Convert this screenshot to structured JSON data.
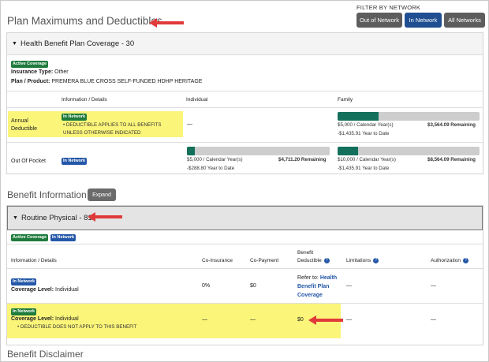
{
  "page_title": "Plan Maximums and Deductibles",
  "filter": {
    "label": "FILTER BY NETWORK",
    "buttons": [
      "Out of Network",
      "In Network",
      "All Networks"
    ],
    "selected": "In Network"
  },
  "plan": {
    "header": "Health Benefit Plan Coverage - 30",
    "badge": "Active Coverage",
    "insurance_type_label": "Insurance Type:",
    "insurance_type": "Other",
    "product_label": "Plan / Product:",
    "product": "PREMERA BLUE CROSS SELF-FUNDED HDHP HERITAGE",
    "columns": [
      "Information / Details",
      "Individual",
      "Family"
    ],
    "rows": [
      {
        "name": "Annual Deductible",
        "network_badge": "In Network",
        "note": "DEDUCTIBLE APPLIES TO ALL BENEFITS UNLESS OTHERWISE INDICATED",
        "individual": "—",
        "family": {
          "limit": "$5,000 / Calendar Year(s)",
          "remaining": "$3,564.09 Remaining",
          "ytd": "-$1,435.91 Year to Date",
          "progress": 0.287
        }
      },
      {
        "name": "Out Of Pocket",
        "network_badge": "In Network",
        "individual": {
          "limit": "$5,000 / Calendar Year(s)",
          "remaining": "$4,711.20 Remaining",
          "ytd": "-$288.80 Year to Date",
          "progress": 0.058
        },
        "family": {
          "limit": "$10,000 / Calendar Year(s)",
          "remaining": "$8,564.09 Remaining",
          "ytd": "-$1,435.91 Year to Date",
          "progress": 0.144
        }
      }
    ]
  },
  "benefit_info": {
    "title": "Benefit Information",
    "expand": "Expand"
  },
  "routine": {
    "header": "Routine Physical - 81",
    "badges": [
      "Active Coverage",
      "In Network"
    ],
    "columns": {
      "info": "Information / Details",
      "coins": "Co-Insurance",
      "copay": "Co-Payment",
      "ded1": "Benefit",
      "ded2": "Deductible",
      "limits": "Limitations",
      "auth": "Authorization"
    },
    "rows": [
      {
        "badge": "In Network",
        "level_label": "Coverage Level:",
        "level": "Individual",
        "coins": "0%",
        "copay": "$0",
        "ded_ref": "Refer to:",
        "ded_link1": "Health",
        "ded_link2": "Benefit Plan",
        "ded_link3": "Coverage",
        "limits": "—",
        "auth": "—"
      },
      {
        "badge": "In Network",
        "level_label": "Coverage Level:",
        "level": "Individual",
        "note": "DEDUCTIBLE DOES NOT APPLY TO THIS BENEFIT",
        "coins": "—",
        "copay": "—",
        "ded": "$0",
        "limits": "—",
        "auth": "—"
      }
    ]
  },
  "disclaimer": "Benefit Disclaimer",
  "colors": {
    "accent_arrow": "#e03a3a",
    "highlight": "#fbf57a",
    "bar_fill": "#13705a",
    "primary": "#1f4f91"
  }
}
